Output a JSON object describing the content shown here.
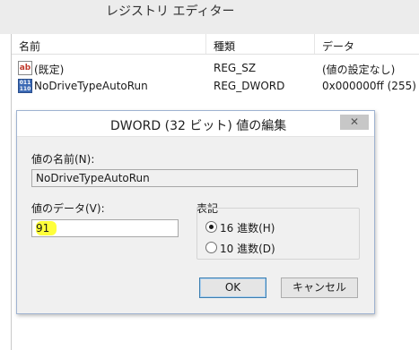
{
  "window": {
    "title": "レジストリ エディター"
  },
  "list": {
    "columns": [
      "名前",
      "種類",
      "データ"
    ],
    "rows": [
      {
        "icon": "ab",
        "name": "(既定)",
        "type": "REG_SZ",
        "data": "(値の設定なし)"
      },
      {
        "icon": "011\n110",
        "name": "NoDriveTypeAutoRun",
        "type": "REG_DWORD",
        "data": "0x000000ff (255)"
      }
    ]
  },
  "dialog": {
    "title": "DWORD (32 ビット) 値の編集",
    "close_label": "✕",
    "value_name_label": "値の名前(N):",
    "value_name": "NoDriveTypeAutoRun",
    "value_data_label": "値のデータ(V):",
    "value_data": "91",
    "base_label": "表記",
    "base_options": [
      {
        "label": "16 進数(H)",
        "checked": true
      },
      {
        "label": "10 進数(D)",
        "checked": false
      }
    ],
    "ok_label": "OK",
    "cancel_label": "キャンセル"
  },
  "colors": {
    "highlight": "#ffff3a",
    "dialog_border": "#9fb3d1"
  }
}
